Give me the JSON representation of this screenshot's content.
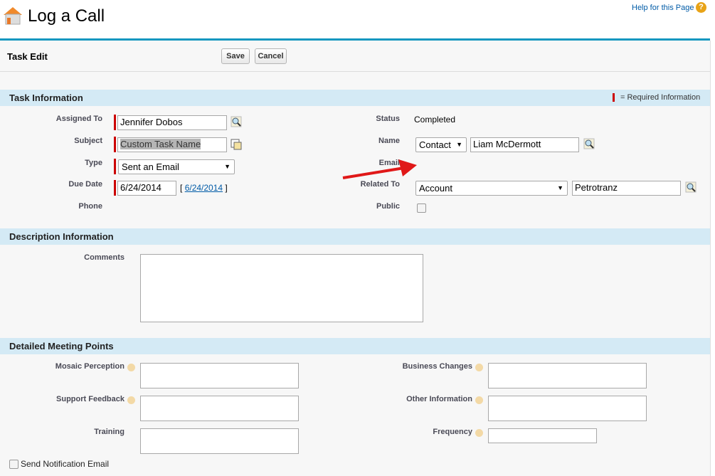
{
  "header": {
    "title": "Log a Call",
    "help_link": "Help for this Page"
  },
  "toolbar": {
    "title": "Task Edit",
    "save": "Save",
    "cancel": "Cancel"
  },
  "task_info": {
    "title": "Task Information",
    "required_legend": "= Required Information",
    "assigned_to_label": "Assigned To",
    "assigned_to": "Jennifer Dobos",
    "subject_label": "Subject",
    "subject": "Custom Task Name",
    "type_label": "Type",
    "type": "Sent an Email",
    "due_date_label": "Due Date",
    "due_date": "6/24/2014",
    "due_date_link": "6/24/2014",
    "bracket_open": "[",
    "bracket_close": "]",
    "phone_label": "Phone",
    "status_label": "Status",
    "status": "Completed",
    "name_label": "Name",
    "name_type": "Contact",
    "name": "Liam McDermott",
    "email_label": "Email",
    "related_to_label": "Related To",
    "related_type": "Account",
    "related": "Petrotranz",
    "public_label": "Public"
  },
  "description": {
    "title": "Description Information",
    "comments_label": "Comments"
  },
  "meeting": {
    "title": "Detailed Meeting Points",
    "mosaic_label": "Mosaic Perception",
    "support_label": "Support Feedback",
    "training_label": "Training",
    "business_label": "Business Changes",
    "other_label": "Other Information",
    "frequency_label": "Frequency"
  },
  "notify": {
    "label": "Send Notification Email"
  },
  "colors": {
    "accent": "#1797c0",
    "section": "#d4eaf5",
    "required": "#cc0000"
  }
}
